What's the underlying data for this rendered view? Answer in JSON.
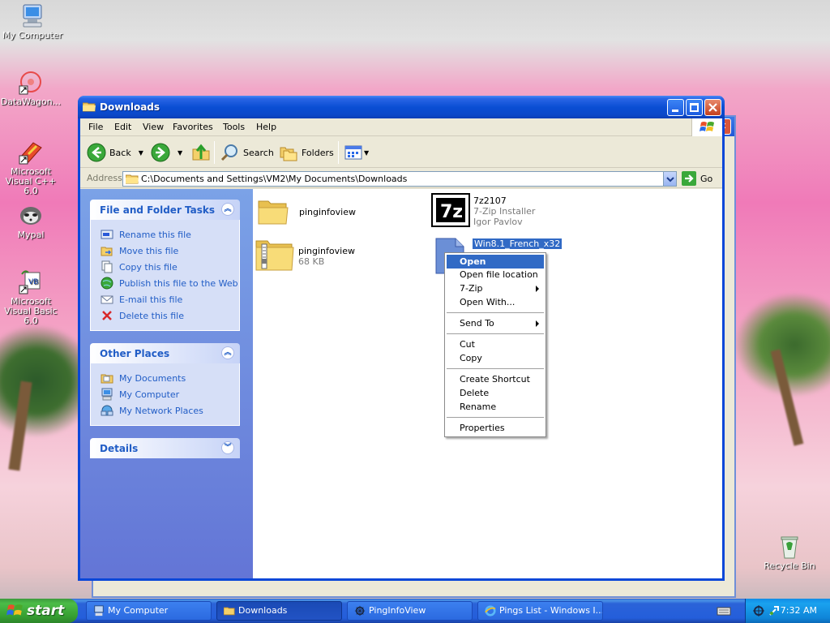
{
  "desktop": {
    "icons": [
      {
        "label": "My Computer"
      },
      {
        "label": "DataWagon..."
      },
      {
        "label": "Microsoft Visual C++ 6.0"
      },
      {
        "label": "Mypal"
      },
      {
        "label": "Microsoft Visual Basic 6.0"
      },
      {
        "label": "Recycle Bin"
      }
    ]
  },
  "window": {
    "title": "Downloads",
    "menu": [
      "File",
      "Edit",
      "View",
      "Favorites",
      "Tools",
      "Help"
    ],
    "toolbar": {
      "back": "Back",
      "search": "Search",
      "folders": "Folders"
    },
    "address": {
      "label": "Address",
      "value": "C:\\Documents and Settings\\VM2\\My Documents\\Downloads",
      "go": "Go"
    }
  },
  "left_pane": {
    "file_tasks": {
      "title": "File and Folder Tasks",
      "items": [
        "Rename this file",
        "Move this file",
        "Copy this file",
        "Publish this file to the Web",
        "E-mail this file",
        "Delete this file"
      ]
    },
    "other_places": {
      "title": "Other Places",
      "items": [
        "My Documents",
        "My Computer",
        "My Network Places"
      ]
    },
    "details": {
      "title": "Details"
    }
  },
  "files": [
    {
      "name": "pinginfoview",
      "type": "folder"
    },
    {
      "name": "7z2107",
      "line2": "7-Zip Installer",
      "line3": "Igor Pavlov",
      "type": "exe"
    },
    {
      "name": "pinginfoview",
      "line2": "68 KB",
      "type": "zip"
    },
    {
      "name": "Win8.1_French_x32",
      "type": "file",
      "selected": true
    }
  ],
  "context_menu": {
    "items": [
      "Open",
      "Open file location",
      "7-Zip",
      "Open With...",
      "Send To",
      "Cut",
      "Copy",
      "Create Shortcut",
      "Delete",
      "Rename",
      "Properties"
    ]
  },
  "taskbar": {
    "start": "start",
    "buttons": [
      "My Computer",
      "Downloads",
      "PingInfoView",
      "Pings List - Windows I..."
    ],
    "clock": "7:32 AM"
  },
  "colors": {
    "accent": "#0a4ed4",
    "task_link": "#215dc6",
    "selection": "#316ac5"
  }
}
